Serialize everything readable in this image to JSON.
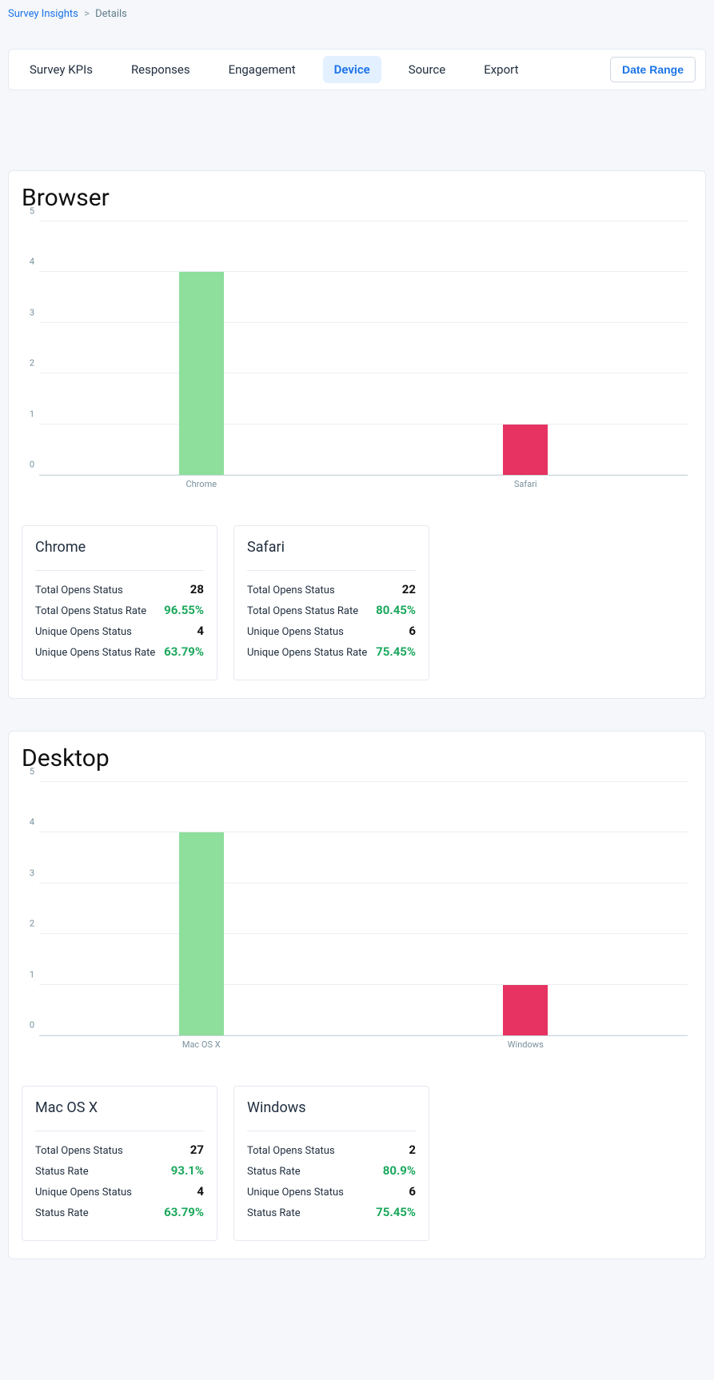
{
  "breadcrumb": {
    "root": "Survey Insights",
    "current": "Details"
  },
  "tabs": {
    "items": [
      "Survey KPIs",
      "Responses",
      "Engagement",
      "Device",
      "Source",
      "Export"
    ],
    "active_index": 3,
    "date_range_label": "Date Range"
  },
  "panels": [
    {
      "title": "Browser",
      "cards": [
        {
          "title": "Chrome",
          "rows": [
            {
              "label": "Total Opens Status",
              "value": "28",
              "green": false
            },
            {
              "label": "Total Opens Status Rate",
              "value": "96.55%",
              "green": true
            },
            {
              "label": "Unique Opens Status",
              "value": "4",
              "green": false
            },
            {
              "label": "Unique Opens Status Rate",
              "value": "63.79%",
              "green": true
            }
          ]
        },
        {
          "title": "Safari",
          "rows": [
            {
              "label": "Total Opens Status",
              "value": "22",
              "green": false
            },
            {
              "label": "Total Opens Status Rate",
              "value": "80.45%",
              "green": true
            },
            {
              "label": "Unique Opens Status",
              "value": "6",
              "green": false
            },
            {
              "label": "Unique Opens Status Rate",
              "value": "75.45%",
              "green": true
            }
          ]
        }
      ]
    },
    {
      "title": "Desktop",
      "cards": [
        {
          "title": "Mac OS X",
          "rows": [
            {
              "label": "Total Opens Status",
              "value": "27",
              "green": false
            },
            {
              "label": "Status Rate",
              "value": "93.1%",
              "green": true
            },
            {
              "label": "Unique Opens Status",
              "value": "4",
              "green": false
            },
            {
              "label": "Status Rate",
              "value": "63.79%",
              "green": true
            }
          ]
        },
        {
          "title": "Windows",
          "rows": [
            {
              "label": "Total Opens Status",
              "value": "2",
              "green": false
            },
            {
              "label": "Status Rate",
              "value": "80.9%",
              "green": true
            },
            {
              "label": "Unique Opens Status",
              "value": "6",
              "green": false
            },
            {
              "label": "Status Rate",
              "value": "75.45%",
              "green": true
            }
          ]
        }
      ]
    }
  ],
  "chart_data": [
    {
      "type": "bar",
      "title": "Browser",
      "categories": [
        "Chrome",
        "Safari"
      ],
      "values": [
        4,
        1
      ],
      "colors": [
        "#8ede9c",
        "#e63361"
      ],
      "ylim": [
        0,
        5
      ],
      "yticks": [
        0,
        1,
        2,
        3,
        4,
        5
      ],
      "xlabel": "",
      "ylabel": ""
    },
    {
      "type": "bar",
      "title": "Desktop",
      "categories": [
        "Mac OS X",
        "Windows"
      ],
      "values": [
        4,
        1
      ],
      "colors": [
        "#8ede9c",
        "#e63361"
      ],
      "ylim": [
        0,
        5
      ],
      "yticks": [
        0,
        1,
        2,
        3,
        4,
        5
      ],
      "xlabel": "",
      "ylabel": ""
    }
  ]
}
